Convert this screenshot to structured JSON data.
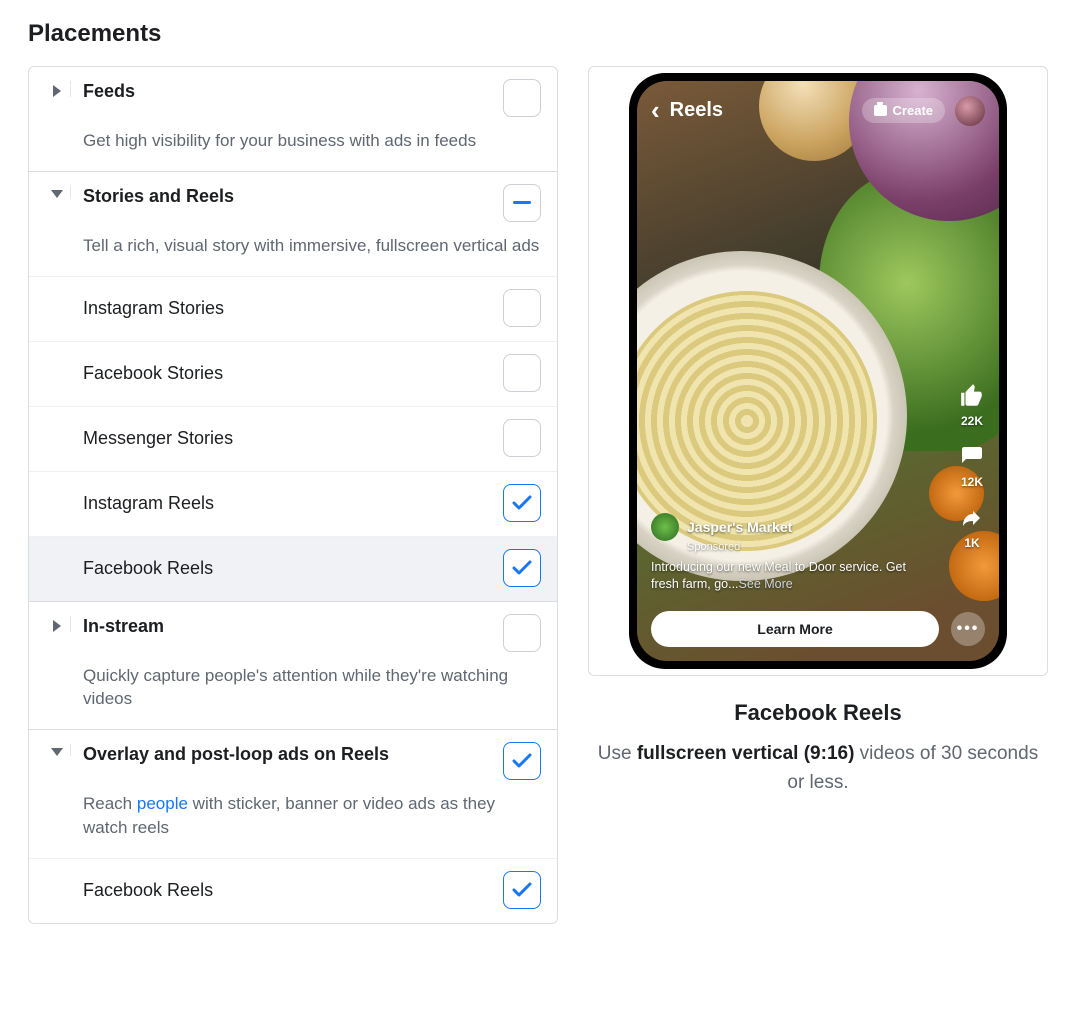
{
  "page_title": "Placements",
  "groups": [
    {
      "id": "feeds",
      "expanded": false,
      "checkbox_state": "unchecked",
      "title": "Feeds",
      "description": "Get high visibility for your business with ads in feeds",
      "items": []
    },
    {
      "id": "stories-reels",
      "expanded": true,
      "checkbox_state": "indeterminate",
      "title": "Stories and Reels",
      "description": "Tell a rich, visual story with immersive, fullscreen vertical ads",
      "items": [
        {
          "id": "ig-stories",
          "label": "Instagram Stories",
          "checked": false,
          "highlight": false
        },
        {
          "id": "fb-stories",
          "label": "Facebook Stories",
          "checked": false,
          "highlight": false
        },
        {
          "id": "msg-stories",
          "label": "Messenger Stories",
          "checked": false,
          "highlight": false
        },
        {
          "id": "ig-reels",
          "label": "Instagram Reels",
          "checked": true,
          "highlight": false
        },
        {
          "id": "fb-reels",
          "label": "Facebook Reels",
          "checked": true,
          "highlight": true
        }
      ]
    },
    {
      "id": "in-stream",
      "expanded": false,
      "checkbox_state": "unchecked",
      "title": "In-stream",
      "description": "Quickly capture people's attention while they're watching videos",
      "items": []
    },
    {
      "id": "overlay-reels",
      "expanded": true,
      "checkbox_state": "checked",
      "title": "Overlay and post-loop ads on Reels",
      "description_pre": "Reach ",
      "description_link": "people",
      "description_post": " with sticker, banner or video ads as they watch reels",
      "items": [
        {
          "id": "overlay-fb-reels",
          "label": "Facebook Reels",
          "checked": true,
          "highlight": false
        }
      ]
    }
  ],
  "preview": {
    "top_bar": {
      "title": "Reels",
      "create_label": "Create"
    },
    "rail": {
      "likes": "22K",
      "comments": "12K",
      "shares": "1K"
    },
    "ad": {
      "advertiser": "Jasper's Market",
      "sponsored": "Sponsored",
      "caption_visible": "Introducing our new Meal to Door service. Get fresh farm, go...",
      "see_more": "See More",
      "cta": "Learn More"
    },
    "title": "Facebook Reels",
    "description_pre": "Use ",
    "description_bold": "fullscreen vertical (9:16)",
    "description_post": " videos of 30 seconds or less."
  },
  "colors": {
    "accent": "#1877f2",
    "border": "#dadde1",
    "muted": "#606770",
    "highlight_bg": "#f0f2f5"
  }
}
